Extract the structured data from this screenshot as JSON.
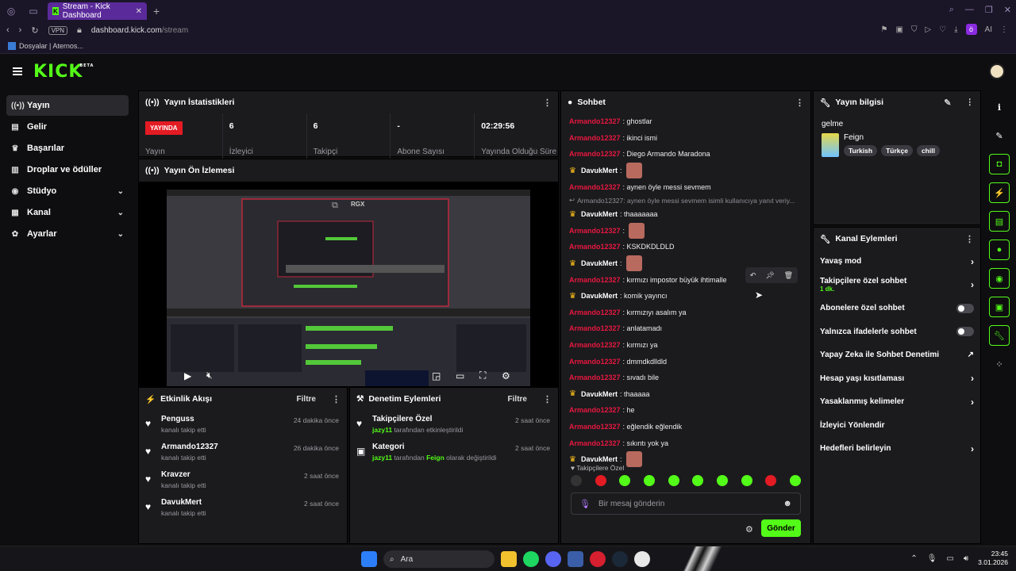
{
  "browser": {
    "tab_title": "Stream - Kick Dashboard",
    "tab_favicon": "K",
    "vpn_label": "VPN",
    "url_domain": "dashboard.kick.com",
    "url_path": "/stream",
    "ai_label": "AI",
    "bookmark": "Dosyalar | Aternos..."
  },
  "brand": {
    "logo": "KICK",
    "beta": "BETA",
    "accent": "#53fc18"
  },
  "sidebar": {
    "items": [
      {
        "label": "Yayın",
        "icon": "broadcast-icon"
      },
      {
        "label": "Gelir",
        "icon": "revenue-icon"
      },
      {
        "label": "Başarılar",
        "icon": "trophy-icon"
      },
      {
        "label": "Droplar ve ödüller",
        "icon": "drops-icon"
      },
      {
        "label": "Stüdyo",
        "icon": "studio-icon"
      },
      {
        "label": "Kanal",
        "icon": "channel-icon"
      },
      {
        "label": "Ayarlar",
        "icon": "gear-icon"
      }
    ]
  },
  "stats": {
    "title": "Yayın İstatistikleri",
    "live_badge": "YAYINDA",
    "live_label": "Yayın",
    "viewers_val": "6",
    "viewers_label": "İzleyici",
    "followers_val": "6",
    "followers_label": "Takipçi",
    "subs_val": "-",
    "subs_label": "Abone Sayısı",
    "uptime_val": "02:29:56",
    "uptime_label": "Yayında Olduğu Süre"
  },
  "preview": {
    "title": "Yayın Ön İzlemesi",
    "overlay_text": "RGX"
  },
  "events": {
    "title": "Etkinlik Akışı",
    "filter": "Filtre",
    "items": [
      {
        "who": "Penguss",
        "what": "kanalı takip etti",
        "when": "24 dakika önce"
      },
      {
        "who": "Armando12327",
        "what": "kanalı takip etti",
        "when": "26 dakika önce"
      },
      {
        "who": "Kravzer",
        "what": "kanalı takip etti",
        "when": "2 saat önce"
      },
      {
        "who": "DavukMert",
        "what": "kanalı takip etti",
        "when": "2 saat önce"
      }
    ]
  },
  "moderation": {
    "title": "Denetim Eylemleri",
    "filter": "Filtre",
    "items": [
      {
        "who": "Takipçilere Özel",
        "actor": "jazy11",
        "what": "tarafından etkinleştirildi",
        "when": "2 saat önce"
      },
      {
        "who": "Kategori",
        "actor": "jazy11",
        "what_pre": "tarafından",
        "target": "Feign",
        "what_post": "olarak değiştirildi",
        "when": "2 saat önce"
      }
    ]
  },
  "chat": {
    "title": "Sohbet",
    "messages": [
      {
        "user": "Armando12327",
        "text": ": ghostlar",
        "style": "red"
      },
      {
        "user": "Armando12327",
        "text": ": ikinci ismi",
        "style": "red"
      },
      {
        "user": "Armando12327",
        "text": ": Diego Armando Maradona",
        "style": "red"
      },
      {
        "user": "DavukMert",
        "text": ":",
        "style": "owner",
        "emote": true
      },
      {
        "user": "Armando12327",
        "text": ": aynen öyle messi sevmem",
        "style": "red"
      },
      {
        "reply": "Armando12327: aynen öyle messi sevmem isimli kullanıcıya yanıt veriy..."
      },
      {
        "user": "DavukMert",
        "text": ": thaaaaaaa",
        "style": "owner"
      },
      {
        "user": "Armando12327",
        "text": ":",
        "style": "red",
        "emote": true
      },
      {
        "user": "Armando12327",
        "text": ": KSKDKDLDLD",
        "style": "red"
      },
      {
        "user": "DavukMert",
        "text": ":",
        "style": "owner",
        "emote": true
      },
      {
        "user": "Armando12327",
        "text": ": kırmızı impostor büyük ihtimalle",
        "style": "red"
      },
      {
        "user": "DavukMert",
        "text": ": komik yayıncı",
        "style": "owner"
      },
      {
        "user": "Armando12327",
        "text": ": kırmızıyı asalım ya",
        "style": "red"
      },
      {
        "user": "Armando12327",
        "text": ": anlatamadı",
        "style": "red"
      },
      {
        "user": "Armando12327",
        "text": ": kırmızı ya",
        "style": "red"
      },
      {
        "user": "Armando12327",
        "text": ": dmmdkdlldld",
        "style": "red"
      },
      {
        "user": "Armando12327",
        "text": ": sıvadı bile",
        "style": "red"
      },
      {
        "user": "DavukMert",
        "text": ": thaaaaa",
        "style": "owner"
      },
      {
        "user": "Armando12327",
        "text": ": he",
        "style": "red"
      },
      {
        "user": "Armando12327",
        "text": ": eğlendik eğlendik",
        "style": "red"
      },
      {
        "user": "Armando12327",
        "text": ": sıkıntı yok ya",
        "style": "red"
      },
      {
        "user": "DavukMert",
        "text": ":",
        "style": "owner",
        "emote": true
      }
    ],
    "mode_label": "Takipçilere Özel",
    "input_placeholder": "Bir mesaj gönderin",
    "send_label": "Gönder"
  },
  "stream_info": {
    "title": "Yayın bilgisi",
    "stream_title": "gelme",
    "category": "Feign",
    "tags": [
      "Turkish",
      "Türkçe",
      "chill"
    ]
  },
  "channel_actions": {
    "title": "Kanal Eylemleri",
    "rows": [
      {
        "label": "Yavaş mod",
        "kind": "chev"
      },
      {
        "label": "Takipçilere özel sohbet",
        "sub": "1 dk.",
        "kind": "chev"
      },
      {
        "label": "Abonelere özel sohbet",
        "kind": "toggle"
      },
      {
        "label": "Yalnızca ifadelerle sohbet",
        "kind": "toggle"
      },
      {
        "label": "Yapay Zeka ile Sohbet Denetimi",
        "kind": "ext"
      },
      {
        "label": "Hesap yaşı kısıtlaması",
        "kind": "chev"
      },
      {
        "label": "Yasaklanmış kelimeler",
        "kind": "chev"
      },
      {
        "label": "İzleyici Yönlendir",
        "kind": "none"
      },
      {
        "label": "Hedefleri belirleyin",
        "kind": "chev"
      }
    ]
  },
  "taskbar": {
    "search_label": "Ara",
    "time": "23:45",
    "date": "3.01.2026"
  }
}
